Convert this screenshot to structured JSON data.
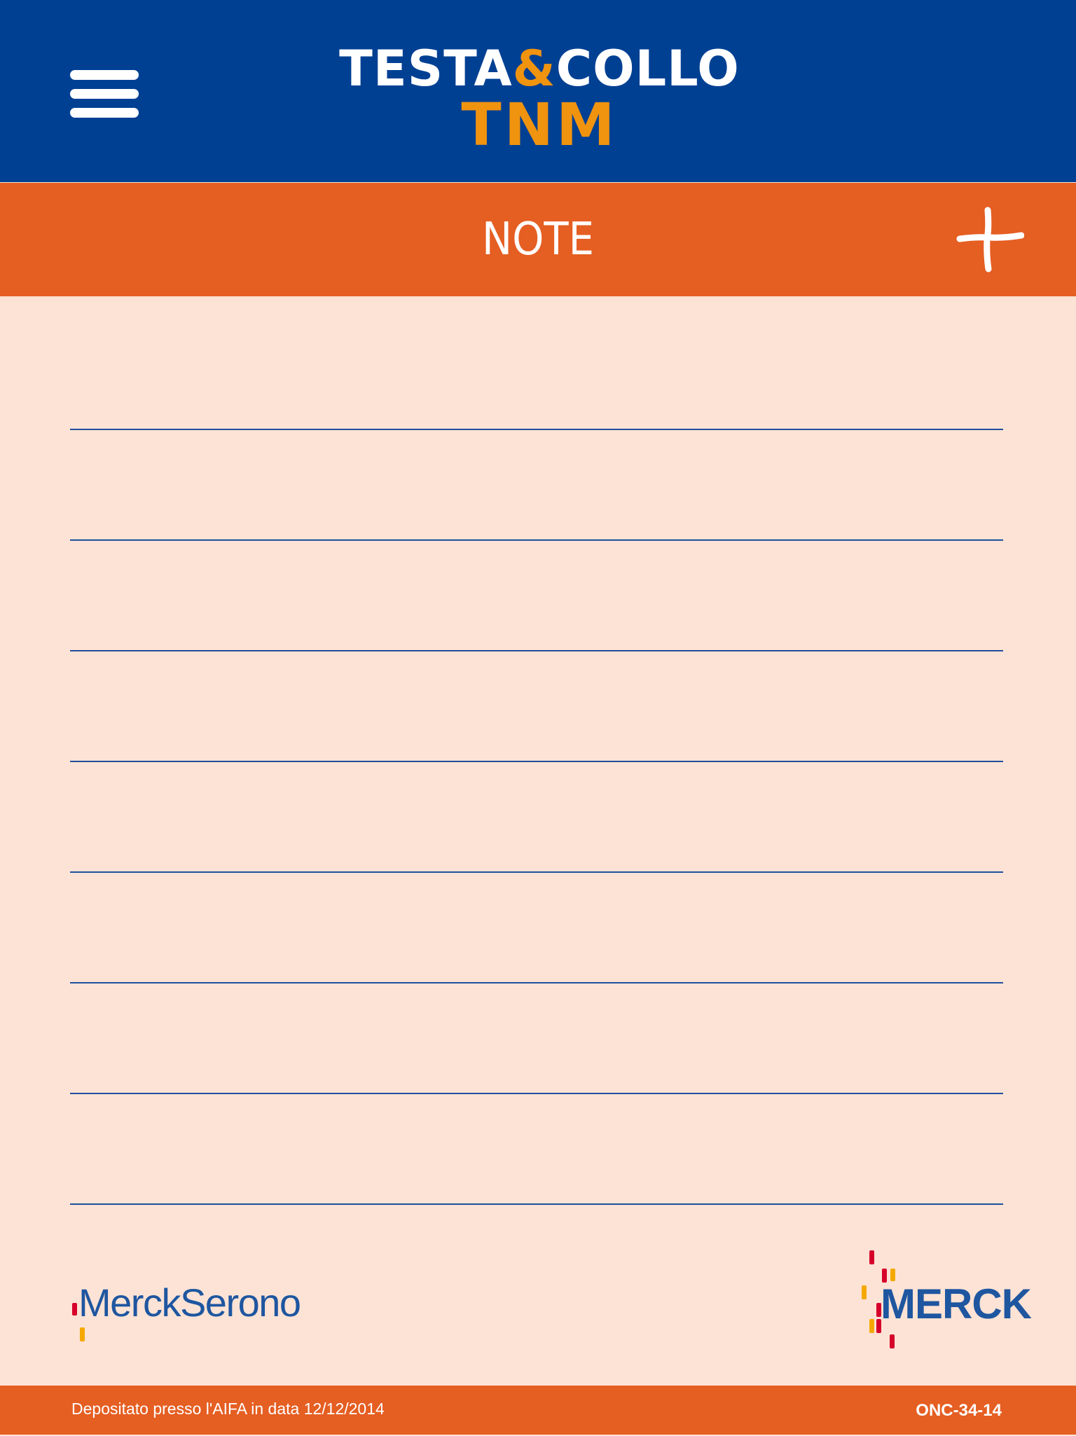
{
  "header": {
    "menu_icon": "hamburger-menu-icon",
    "logo": {
      "line1_part1": "TESTA",
      "amp": "&",
      "line1_part2": "COLLO",
      "line2": "TNM"
    }
  },
  "title_bar": {
    "title": "NOTE",
    "add_icon": "plus-icon"
  },
  "notes": {
    "line_count": 8
  },
  "brands": {
    "left_logo": "MerckSerono",
    "right_logo": "MERCK"
  },
  "footer": {
    "note": "Depositato presso l'AIFA in data 12/12/2014",
    "code": "ONC-34-14"
  },
  "colors": {
    "header_bg": "#004093",
    "accent_orange": "#e55e22",
    "logo_orange": "#f0930f",
    "page_bg": "#fde3d5",
    "line_blue": "#1f4f9d",
    "brand_blue": "#1e56a0"
  }
}
